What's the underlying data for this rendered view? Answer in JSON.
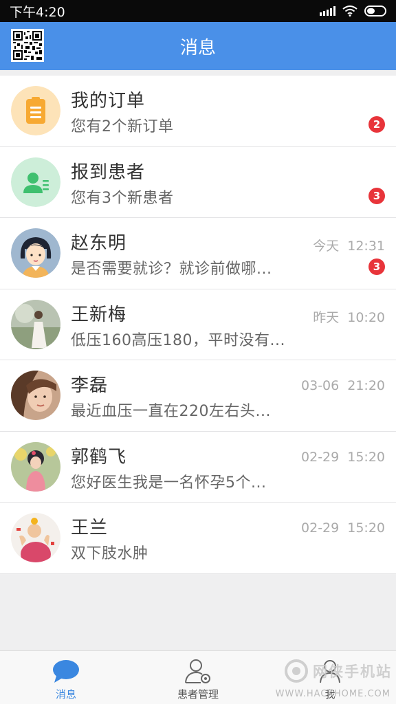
{
  "status_bar": {
    "time": "下午4:20"
  },
  "header": {
    "title": "消息"
  },
  "messages": [
    {
      "name": "我的订单",
      "preview": "您有2个新订单",
      "badge": "2",
      "day": "",
      "time": "",
      "avatar": "order-icon"
    },
    {
      "name": "报到患者",
      "preview": "您有3个新患者",
      "badge": "3",
      "day": "",
      "time": "",
      "avatar": "patient-icon"
    },
    {
      "name": "赵东明",
      "preview": "是否需要就诊？就诊前做哪...",
      "badge": "3",
      "day": "今天",
      "time": "12:31",
      "avatar": "cartoon-woman-avatar"
    },
    {
      "name": "王新梅",
      "preview": "低压160高压180，平时没有...",
      "badge": "",
      "day": "昨天",
      "time": "10:20",
      "avatar": "photo-avatar"
    },
    {
      "name": "李磊",
      "preview": "最近血压一直在220左右头...",
      "badge": "",
      "day": "03-06",
      "time": "21:20",
      "avatar": "photo-avatar"
    },
    {
      "name": "郭鹤飞",
      "preview": "您好医生我是一名怀孕5个...",
      "badge": "",
      "day": "02-29",
      "time": "15:20",
      "avatar": "photo-avatar"
    },
    {
      "name": "王兰",
      "preview": "双下肢水肿",
      "badge": "",
      "day": "02-29",
      "time": "15:20",
      "avatar": "photo-avatar"
    }
  ],
  "tabs": [
    {
      "label": "消息",
      "icon": "chat-bubble-icon",
      "active": true
    },
    {
      "label": "患者管理",
      "icon": "patient-manage-icon",
      "active": false
    },
    {
      "label": "我",
      "icon": "person-icon",
      "active": false
    }
  ],
  "watermark": {
    "text": "网侠手机站",
    "url": "WWW.HACKHOME.COM"
  },
  "colors": {
    "header_bg": "#4a90e8",
    "badge": "#e8343a",
    "active_tab": "#3a87e0",
    "order_circle": "#fde3b8",
    "patient_circle": "#cdeed9"
  }
}
